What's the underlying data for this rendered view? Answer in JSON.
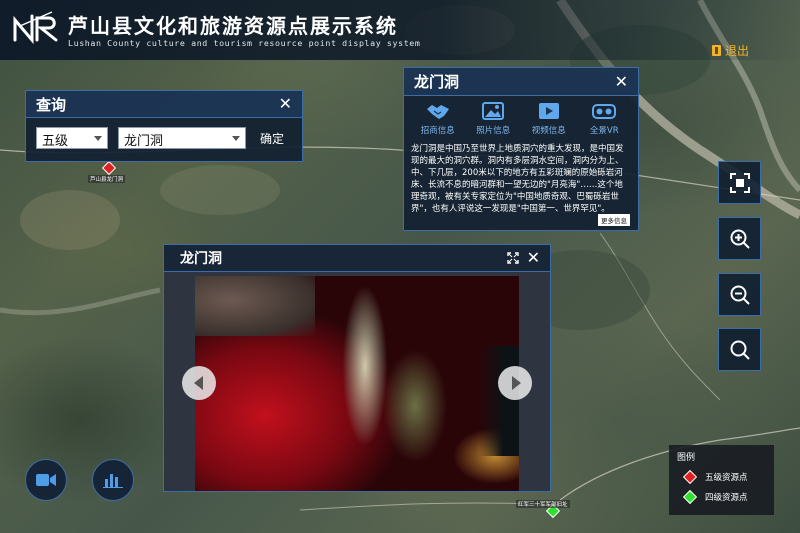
{
  "header": {
    "title": "芦山县文化和旅游资源点展示系统",
    "subtitle": "Lushan County culture and tourism resource point display system",
    "logout_label": "退出"
  },
  "query_panel": {
    "title": "查询",
    "level_value": "五级",
    "name_value": "龙门洞",
    "confirm_label": "确定"
  },
  "info_panel": {
    "title": "龙门洞",
    "tabs": [
      {
        "label": "招商信息",
        "icon": "handshake-icon"
      },
      {
        "label": "照片信息",
        "icon": "photo-icon"
      },
      {
        "label": "视频信息",
        "icon": "video-icon"
      },
      {
        "label": "全景VR",
        "icon": "vr-icon"
      }
    ],
    "description": "龙门洞是中国乃至世界上地质洞穴的重大发现，是中国发现的最大的洞穴群。洞内有多层洞水空间，洞内分为上、中、下几层，200米以下的地方有五彩斑斓的原始砾岩河床、长流不息的暗河群和一望无边的\"月亮海\"……这个地理奇观，被有关专家定位为\"中国地质奇观、巴蜀砾岩世界\"，也有人评说这一发现是\"中国第一、世界罕见\"。",
    "more_label": "更多信息"
  },
  "viewer": {
    "title": "龙门洞"
  },
  "legend": {
    "title": "图例",
    "items": [
      {
        "label": "五级资源点",
        "color": "#e02020"
      },
      {
        "label": "四级资源点",
        "color": "#30e030"
      }
    ]
  },
  "map": {
    "marker_label_red": "芦山县龙门洞",
    "marker_label_green": "红军三十军军部旧址"
  },
  "controls": {
    "fullscreen_icon": "fullscreen-icon",
    "zoom_in_icon": "zoom-in-icon",
    "zoom_out_icon": "zoom-out-icon",
    "search_icon": "search-icon"
  }
}
